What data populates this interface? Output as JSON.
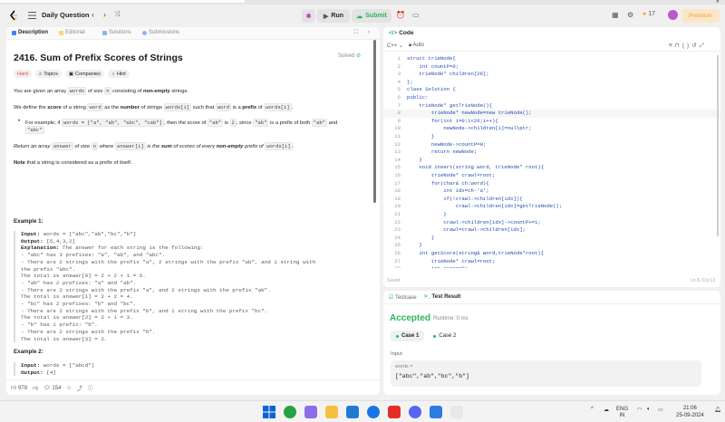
{
  "nav": {
    "title": "Daily Question",
    "run_label": "Run",
    "submit_label": "Submit",
    "streak_count": "17",
    "premium_label": "Premium"
  },
  "left_tabs": [
    "Description",
    "Editorial",
    "Solutions",
    "Submissions"
  ],
  "problem": {
    "title": "2416. Sum of Prefix Scores of Strings",
    "status": "Solved",
    "chips": [
      "Hard",
      "Topics",
      "Companies",
      "Hint"
    ],
    "p1": [
      "You are given an array ",
      "words",
      " of size ",
      "n",
      " consisting of ",
      "non-empty",
      " strings."
    ],
    "p2": [
      "We define the ",
      "score",
      " of a string ",
      "word",
      " as the ",
      "number",
      " of strings ",
      "words[i]",
      " such that ",
      "word",
      " is a ",
      "prefix",
      " of ",
      "words[i]",
      "."
    ],
    "bullet_a": [
      "For example, if ",
      "words = [\"a\", \"ab\", \"abc\", \"cab\"]",
      ", then the score of ",
      "\"ab\"",
      " is ",
      "2",
      ", since ",
      "\"ab\"",
      " is a prefix of both ",
      "\"ab\"",
      " and"
    ],
    "bullet_b": "\"abc\"",
    "p3": [
      "Return an array ",
      "answer",
      " of size ",
      "n",
      " where ",
      "answer[i]",
      " is the ",
      "sum",
      " of scores of every ",
      "non-empty",
      " prefix of ",
      "words[i]",
      "."
    ],
    "p4": [
      "Note",
      " that a string is considered as a prefix of itself."
    ],
    "example1_title": "Example 1:",
    "example1_lines": [
      {
        "label": "Input:",
        "text": " words = [\"abc\",\"ab\",\"bc\",\"b\"]"
      },
      {
        "label": "Output:",
        "text": " [5,4,3,2]"
      },
      {
        "label": "Explanation:",
        "text": " The answer for each string is the following:"
      },
      {
        "label": "",
        "text": "- \"abc\" has 3 prefixes: \"a\", \"ab\", and \"abc\"."
      },
      {
        "label": "",
        "text": "- There are 2 strings with the prefix \"a\", 2 strings with the prefix \"ab\", and 1 string with"
      },
      {
        "label": "",
        "text": "the prefix \"abc\"."
      },
      {
        "label": "",
        "text": "The total is answer[0] = 2 + 2 + 1 = 5."
      },
      {
        "label": "",
        "text": "- \"ab\" has 2 prefixes: \"a\" and \"ab\"."
      },
      {
        "label": "",
        "text": "- There are 2 strings with the prefix \"a\", and 2 strings with the prefix \"ab\"."
      },
      {
        "label": "",
        "text": "The total is answer[1] = 2 + 2 = 4."
      },
      {
        "label": "",
        "text": "- \"bc\" has 2 prefixes: \"b\" and \"bc\"."
      },
      {
        "label": "",
        "text": "- There are 2 strings with the prefix \"b\", and 1 string with the prefix \"bc\"."
      },
      {
        "label": "",
        "text": "The total is answer[2] = 2 + 1 = 3."
      },
      {
        "label": "",
        "text": "- \"b\" has 1 prefix: \"b\"."
      },
      {
        "label": "",
        "text": "- There are 2 strings with the prefix \"b\"."
      },
      {
        "label": "",
        "text": "The total is answer[3] = 2."
      }
    ],
    "example2_title": "Example 2:",
    "example2_lines": [
      {
        "label": "Input:",
        "text": " words = [\"abcd\"]"
      },
      {
        "label": "Output:",
        "text": " [4]"
      }
    ],
    "likes": "979",
    "comments": "154"
  },
  "code_panel": {
    "tab": "Code",
    "lang": "C++",
    "mode": "Auto",
    "saved": "Saved",
    "cursor": "Ln 8, Col 13",
    "lines": [
      "struct trieNode{",
      "    int countP=0;",
      "    trieNode* children[26];",
      "};",
      "class Solution {",
      "public:",
      "    trieNode* getTrieNode(){",
      "        trieNode* newNode=new trieNode();",
      "        for(int i=0;i<26;i++){",
      "            newNode->children[i]=nullptr;",
      "        }",
      "        newNode->countP=0;",
      "        return newNode;",
      "    }",
      "    void insert(string word, trieNode* root){",
      "        trieNode* crawl=root;",
      "        for(char& ch:word){",
      "            int idx=ch-'a';",
      "            if(!crawl->children[idx]){",
      "                crawl->children[idx]=getTrieNode();",
      "            }",
      "            crawl->children[idx]->countP+=1;",
      "            crawl=crawl->children[idx];",
      "        }",
      "    }",
      "    int getScore(string& word,trieNode*root){",
      "        trieNode* crawl=root;",
      "        int score=0;"
    ]
  },
  "result_panel": {
    "tabs": [
      "Testcase",
      "Test Result"
    ],
    "status": "Accepted",
    "runtime": "Runtime: 0 ms",
    "cases": [
      "Case 1",
      "Case 2"
    ],
    "input_label": "Input",
    "var_label": "words =",
    "input_value": "[\"abc\",\"ab\",\"bc\",\"b\"]"
  },
  "taskbar": {
    "lang1": "ENG",
    "lang2": "IN",
    "time": "21:06",
    "date": "25-09-2024"
  },
  "colors": {
    "accent_green": "#2db55d",
    "hard_red": "#ef4743",
    "premium_orange": "#f0a23a",
    "code_blue": "#1f4db0"
  }
}
